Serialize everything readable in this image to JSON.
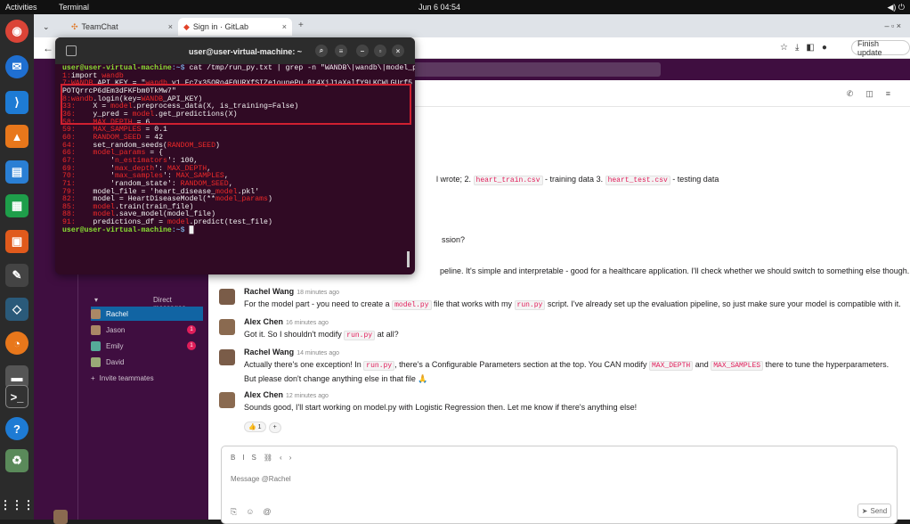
{
  "topbar": {
    "activities": "Activities",
    "app": "Terminal",
    "clock": "Jun 6  04:54"
  },
  "browser": {
    "tabs": [
      {
        "label": "TeamChat"
      },
      {
        "label": "Sign in · GitLab"
      }
    ],
    "new_tab": "+",
    "finish_update": "Finish update"
  },
  "terminal": {
    "title": "user@user-virtual-machine: ~",
    "prompt": "user@user-virtual-machine",
    "path": ":~$",
    "command": " cat /tmp/run_py.txt | grep -n \"WANDB\\|wandb\\|model_params\\|MAX_DEPTH\\|MAX_SAMPLES\\|RANDOM_SEED\\|n_estimators\\|max_depth\\|max_samples\\|model\\.\""
  },
  "sidebar": {
    "direct_messages": "Direct messages",
    "dms": [
      {
        "name": "Rachel",
        "selected": true
      },
      {
        "name": "Jason",
        "badge": "1"
      },
      {
        "name": "Emily",
        "badge": "1"
      },
      {
        "name": "David"
      }
    ],
    "invite": "Invite teammates"
  },
  "chat": {
    "frag1a": "l wrote; 2. ",
    "frag1code1": "heart_train.csv",
    "frag1b": " - training data 3. ",
    "frag1code2": "heart_test.csv",
    "frag1c": " - testing data",
    "frag2": "ssion?",
    "frag3": "peline. It's simple and interpretable - good for a healthcare application. I'll check whether we should switch to something else though.",
    "messages": [
      {
        "author": "Rachel Wang",
        "time": "18 minutes ago",
        "t1": "For the model part - you need to create a ",
        "c1": "model.py",
        "t2": " file that works with my ",
        "c2": "run.py",
        "t3": " script. I've already set up the evaluation pipeline, so just make sure your model is compatible with it."
      },
      {
        "author": "Alex Chen",
        "time": "16 minutes ago",
        "t1": "Got it. So I shouldn't modify ",
        "c1": "run.py",
        "t2": " at all?"
      },
      {
        "author": "Rachel Wang",
        "time": "14 minutes ago",
        "t1": "Actually there's one exception! In ",
        "c1": "run.py",
        "t2": ", there's a Configurable Parameters section at the top. You CAN modify ",
        "c2": "MAX_DEPTH",
        "t3": " and ",
        "c3": "MAX_SAMPLES",
        "t4": " there to tune the hyperparameters. But please don't change anything else in that file 🙏"
      },
      {
        "author": "Alex Chen",
        "time": "12 minutes ago",
        "t1": "Sounds good, I'll start working on model.py with Logistic Regression then. Let me know if there's anything else!",
        "reaction": "👍 1",
        "add_reaction": "+"
      }
    ]
  },
  "composer": {
    "placeholder": "Message @Rachel",
    "send": "Send"
  }
}
